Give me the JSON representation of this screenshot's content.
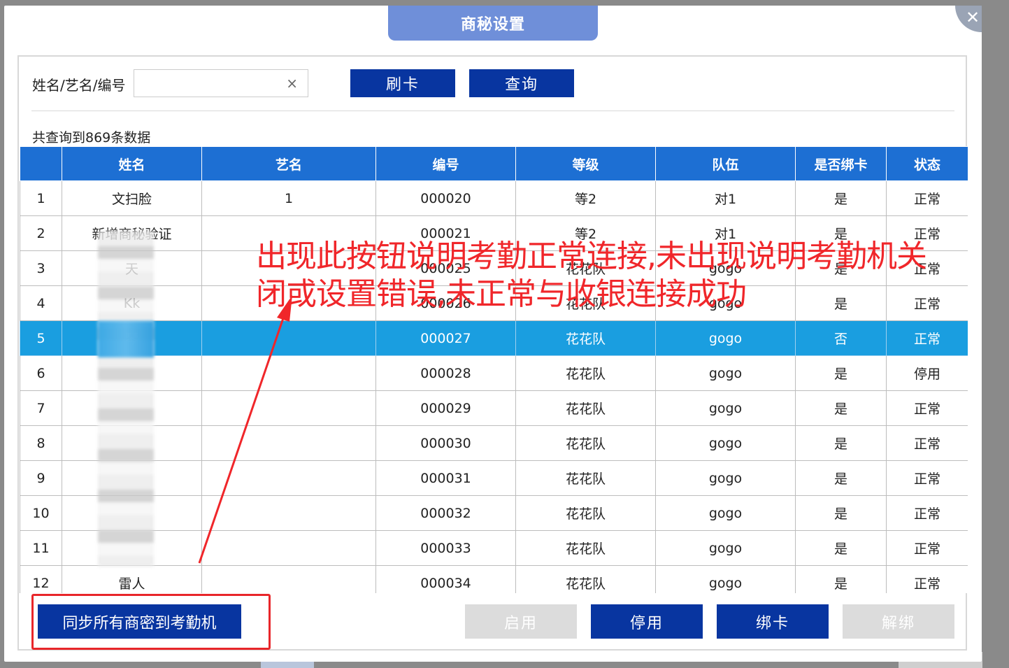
{
  "dialog": {
    "title": "商秘设置",
    "close_icon": "close-icon"
  },
  "search": {
    "label": "姓名/艺名/编号",
    "value": "",
    "placeholder": "",
    "clear_icon": "×",
    "swipe_card_label": "刷卡",
    "query_label": "查询"
  },
  "result_count": "共查询到869条数据",
  "table": {
    "columns": [
      "",
      "姓名",
      "艺名",
      "编号",
      "等级",
      "队伍",
      "是否绑卡",
      "状态"
    ],
    "rows": [
      {
        "no": "1",
        "name": "文扫脸",
        "stage": "1",
        "code": "000020",
        "level": "等2",
        "team": "对1",
        "card": "是",
        "status": "正常"
      },
      {
        "no": "2",
        "name": "新增商秘验证",
        "stage": "",
        "code": "000021",
        "level": "等2",
        "team": "对1",
        "card": "是",
        "status": "正常"
      },
      {
        "no": "3",
        "name": "天",
        "stage": "",
        "code": "000025",
        "level": "花花队",
        "team": "gogo",
        "card": "是",
        "status": "正常"
      },
      {
        "no": "4",
        "name": "Kk",
        "stage": "",
        "code": "000026",
        "level": "花花队",
        "team": "gogo",
        "card": "是",
        "status": "正常"
      },
      {
        "no": "5",
        "name": "琴",
        "stage": "",
        "code": "000027",
        "level": "花花队",
        "team": "gogo",
        "card": "否",
        "status": "正常",
        "selected": true
      },
      {
        "no": "6",
        "name": "",
        "stage": "",
        "code": "000028",
        "level": "花花队",
        "team": "gogo",
        "card": "是",
        "status": "停用"
      },
      {
        "no": "7",
        "name": "",
        "stage": "",
        "code": "000029",
        "level": "花花队",
        "team": "gogo",
        "card": "是",
        "status": "正常"
      },
      {
        "no": "8",
        "name": "",
        "stage": "",
        "code": "000030",
        "level": "花花队",
        "team": "gogo",
        "card": "是",
        "status": "正常"
      },
      {
        "no": "9",
        "name": "",
        "stage": "",
        "code": "000031",
        "level": "花花队",
        "team": "gogo",
        "card": "是",
        "status": "正常"
      },
      {
        "no": "10",
        "name": "",
        "stage": "",
        "code": "000032",
        "level": "花花队",
        "team": "gogo",
        "card": "是",
        "status": "正常"
      },
      {
        "no": "11",
        "name": "",
        "stage": "",
        "code": "000033",
        "level": "花花队",
        "team": "gogo",
        "card": "是",
        "status": "正常"
      },
      {
        "no": "12",
        "name": "雷人",
        "stage": "",
        "code": "000034",
        "level": "花花队",
        "team": "gogo",
        "card": "是",
        "status": "正常"
      }
    ]
  },
  "annotation": {
    "line1": "出现此按钮说明考勤正常连接,未出现说明考勤机关",
    "line2": "闭或设置错误,未正常与收银连接成功"
  },
  "footer": {
    "sync_label": "同步所有商密到考勤机",
    "enable_label": "启用",
    "disable_label": "停用",
    "bind_label": "绑卡",
    "unbind_label": "解绑"
  },
  "colors": {
    "header": "#1d6fd3",
    "selected_row": "#1a9ee0",
    "primary_button": "#0835a0",
    "annotation": "#f0262a",
    "title_tab": "#6f8fd9"
  }
}
